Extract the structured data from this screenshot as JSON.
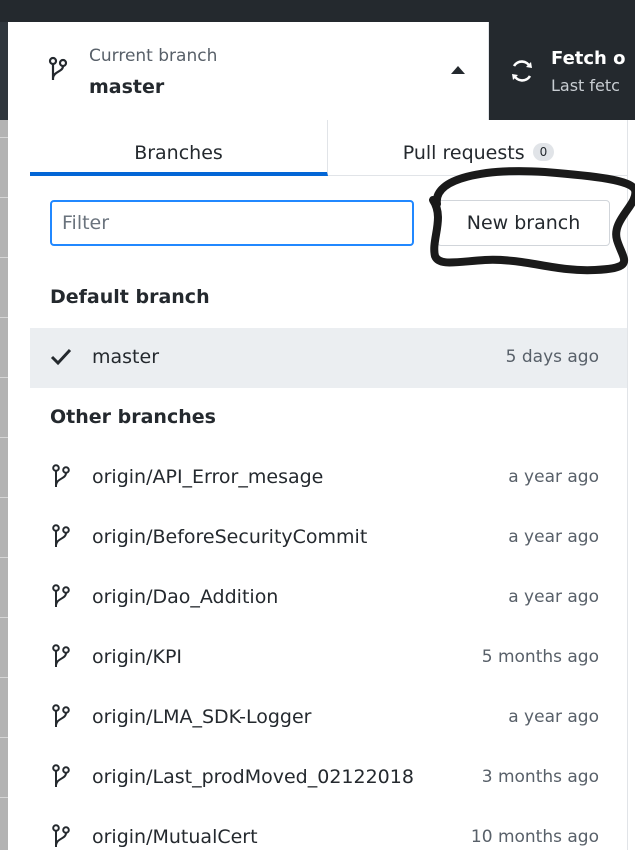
{
  "toolbar": {
    "current_branch_label": "Current branch",
    "current_branch_value": "master",
    "fetch_title": "Fetch o",
    "fetch_subtitle": "Last fetc"
  },
  "tabs": [
    {
      "label": "Branches",
      "active": true
    },
    {
      "label": "Pull requests",
      "count": "0",
      "active": false
    }
  ],
  "filter": {
    "placeholder": "Filter",
    "value": ""
  },
  "new_branch_label": "New branch",
  "default_section": {
    "title": "Default branch",
    "items": [
      {
        "name": "master",
        "time": "5 days ago",
        "selected": true
      }
    ]
  },
  "other_section": {
    "title": "Other branches",
    "items": [
      {
        "name": "origin/API_Error_mesage",
        "time": "a year ago"
      },
      {
        "name": "origin/BeforeSecurityCommit",
        "time": "a year ago"
      },
      {
        "name": "origin/Dao_Addition",
        "time": "a year ago"
      },
      {
        "name": "origin/KPI",
        "time": "5 months ago"
      },
      {
        "name": "origin/LMA_SDK-Logger",
        "time": "a year ago"
      },
      {
        "name": "origin/Last_prodMoved_02122018",
        "time": "3 months ago"
      },
      {
        "name": "origin/MutualCert",
        "time": "10 months ago"
      }
    ]
  },
  "colors": {
    "accent": "#0366d6",
    "toolbar_dark": "#24292e",
    "selected_row": "#ebeef1",
    "annotation_ink": "#1a1a1a"
  }
}
